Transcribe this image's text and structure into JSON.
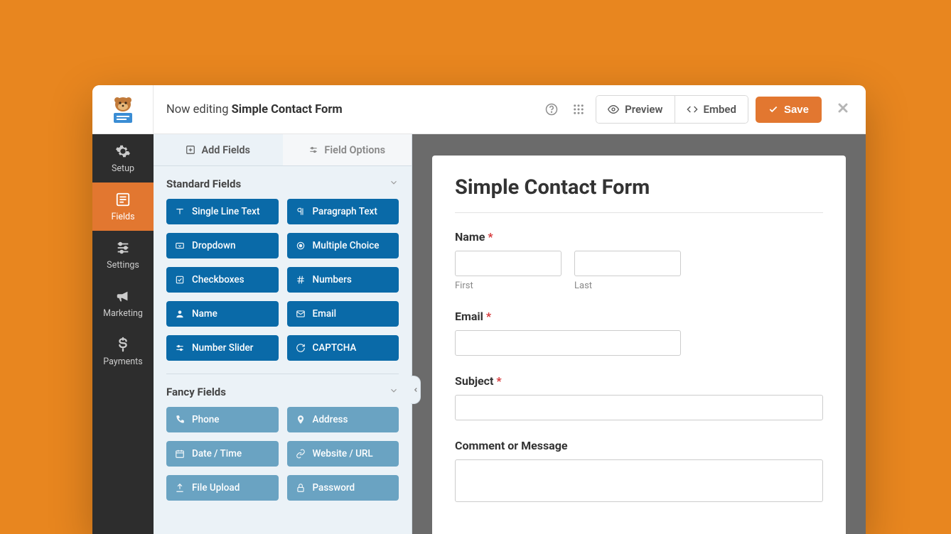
{
  "topbar": {
    "editing_prefix": "Now editing ",
    "form_name": "Simple Contact Form",
    "preview_label": "Preview",
    "embed_label": "Embed",
    "save_label": "Save"
  },
  "sidebar": {
    "items": [
      {
        "label": "Setup"
      },
      {
        "label": "Fields"
      },
      {
        "label": "Settings"
      },
      {
        "label": "Marketing"
      },
      {
        "label": "Payments"
      }
    ]
  },
  "panel": {
    "tabs": {
      "add": "Add Fields",
      "options": "Field Options"
    },
    "sections": {
      "standard": {
        "title": "Standard Fields",
        "items": [
          "Single Line Text",
          "Paragraph Text",
          "Dropdown",
          "Multiple Choice",
          "Checkboxes",
          "Numbers",
          "Name",
          "Email",
          "Number Slider",
          "CAPTCHA"
        ]
      },
      "fancy": {
        "title": "Fancy Fields",
        "items": [
          "Phone",
          "Address",
          "Date / Time",
          "Website / URL",
          "File Upload",
          "Password"
        ]
      }
    }
  },
  "form": {
    "title": "Simple Contact Form",
    "fields": {
      "name": {
        "label": "Name",
        "first": "First",
        "last": "Last"
      },
      "email": {
        "label": "Email"
      },
      "subject": {
        "label": "Subject"
      },
      "comment": {
        "label": "Comment or Message"
      }
    }
  }
}
